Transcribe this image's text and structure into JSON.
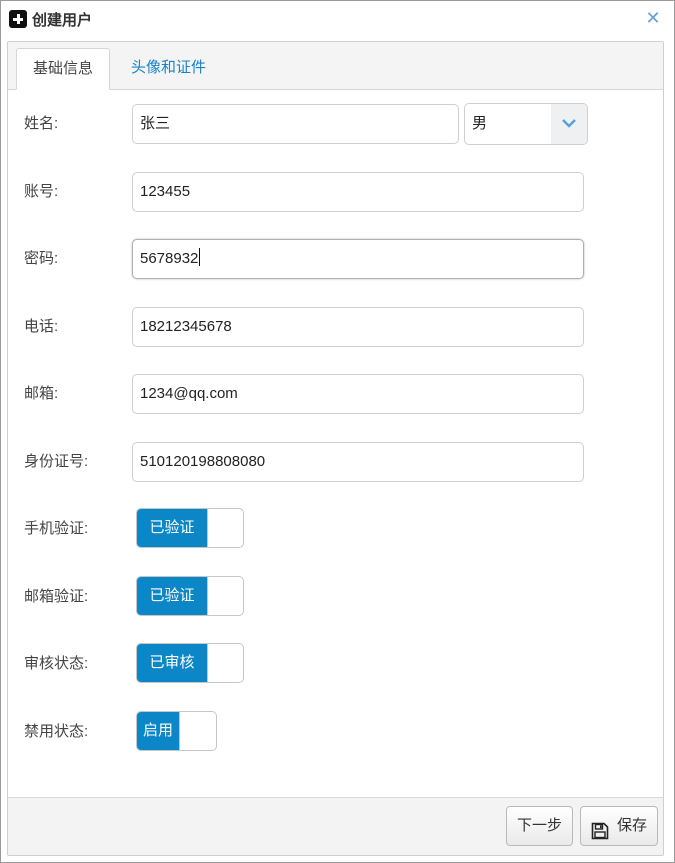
{
  "window": {
    "title": "创建用户",
    "close_symbol": "✕"
  },
  "tabs": [
    {
      "label": "基础信息",
      "active": true
    },
    {
      "label": "头像和证件",
      "active": false
    }
  ],
  "form": {
    "name": {
      "label": "姓名:",
      "value": "张三",
      "gender_value": "男"
    },
    "account": {
      "label": "账号:",
      "value": "123455"
    },
    "password": {
      "label": "密码:",
      "value": "5678932"
    },
    "phone": {
      "label": "电话:",
      "value": "18212345678"
    },
    "email": {
      "label": "邮箱:",
      "value": "1234@qq.com"
    },
    "id_number": {
      "label": "身份证号:",
      "value": "510120198808080"
    },
    "phone_verify": {
      "label": "手机验证:",
      "toggle_text": "已验证"
    },
    "email_verify": {
      "label": "邮箱验证:",
      "toggle_text": "已验证"
    },
    "review_status": {
      "label": "审核状态:",
      "toggle_text": "已审核"
    },
    "disable_status": {
      "label": "禁用状态:",
      "toggle_text": "启用"
    }
  },
  "footer": {
    "next_label": "下一步",
    "save_label": "保存"
  },
  "icons": {
    "title": "add-box-icon",
    "close": "close-icon",
    "dropdown": "chevron-down-icon",
    "save": "floppy-disk-icon"
  },
  "colors": {
    "accent": "#0b86c6",
    "tab_link": "#1a83c7",
    "close": "#6a9fd0"
  }
}
